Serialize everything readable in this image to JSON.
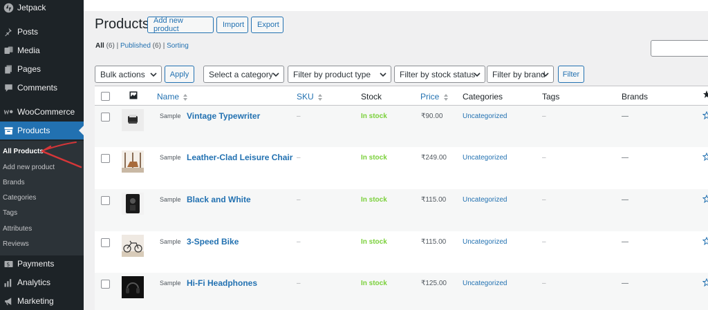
{
  "sidebar": {
    "items": [
      {
        "label": "Jetpack",
        "icon": "jetpack-icon"
      },
      {
        "label": "Posts",
        "icon": "pin-icon"
      },
      {
        "label": "Media",
        "icon": "media-icon"
      },
      {
        "label": "Pages",
        "icon": "pages-icon"
      },
      {
        "label": "Comments",
        "icon": "comment-icon"
      },
      {
        "label": "WooCommerce",
        "icon": "woocommerce-icon"
      },
      {
        "label": "Products",
        "icon": "archive-icon"
      },
      {
        "label": "Payments",
        "icon": "payments-icon"
      },
      {
        "label": "Analytics",
        "icon": "analytics-icon"
      },
      {
        "label": "Marketing",
        "icon": "megaphone-icon"
      }
    ],
    "submenu": [
      "All Products",
      "Add new product",
      "Brands",
      "Categories",
      "Tags",
      "Attributes",
      "Reviews"
    ]
  },
  "header": {
    "title": "Products",
    "add_new_label": "Add new product",
    "import_label": "Import",
    "export_label": "Export"
  },
  "views": {
    "all_label": "All",
    "all_count": "(6)",
    "sep1": "|",
    "published_label": "Published",
    "published_count": "(6)",
    "sep2": "|",
    "sorting_label": "Sorting"
  },
  "toolbar": {
    "bulk_actions": "Bulk actions",
    "apply_label": "Apply",
    "category_select": "Select a category",
    "product_type_select": "Filter by product type",
    "stock_status_select": "Filter by stock status",
    "brand_select": "Filter by brand",
    "filter_label": "Filter"
  },
  "table": {
    "columns": {
      "name": "Name",
      "sku": "SKU",
      "stock": "Stock",
      "price": "Price",
      "categories": "Categories",
      "tags": "Tags",
      "brands": "Brands"
    },
    "rows": [
      {
        "sample": "Sample",
        "name": "Vintage Typewriter",
        "sku": "–",
        "stock": "In stock",
        "price": "₹90.00",
        "category": "Uncategorized",
        "tags": "–",
        "brands": "—"
      },
      {
        "sample": "Sample",
        "name": "Leather-Clad Leisure Chair",
        "sku": "–",
        "stock": "In stock",
        "price": "₹249.00",
        "category": "Uncategorized",
        "tags": "–",
        "brands": "—"
      },
      {
        "sample": "Sample",
        "name": "Black and White",
        "sku": "–",
        "stock": "In stock",
        "price": "₹115.00",
        "category": "Uncategorized",
        "tags": "–",
        "brands": "—"
      },
      {
        "sample": "Sample",
        "name": "3-Speed Bike",
        "sku": "–",
        "stock": "In stock",
        "price": "₹115.00",
        "category": "Uncategorized",
        "tags": "–",
        "brands": "—"
      },
      {
        "sample": "Sample",
        "name": "Hi-Fi Headphones",
        "sku": "–",
        "stock": "In stock",
        "price": "₹125.00",
        "category": "Uncategorized",
        "tags": "–",
        "brands": "—"
      }
    ]
  },
  "colors": {
    "sidebar_bg": "#1d2327",
    "active_menu": "#2271b1",
    "link": "#2271b1",
    "in_stock": "#7ad03a",
    "annotation_arrow": "#d63638"
  }
}
